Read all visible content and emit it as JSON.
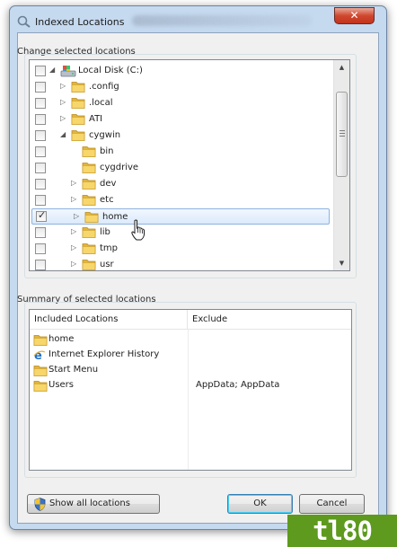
{
  "window": {
    "title": "Indexed Locations",
    "close_glyph": "✕"
  },
  "change_section": {
    "label": "Change selected locations"
  },
  "tree": [
    {
      "label": "Local Disk (C:)",
      "checked": false,
      "expander": "expanded",
      "icon": "drive-icon"
    },
    {
      "label": ".config",
      "checked": false,
      "expander": "collapsed",
      "icon": "folder-icon"
    },
    {
      "label": ".local",
      "checked": false,
      "expander": "collapsed",
      "icon": "folder-icon"
    },
    {
      "label": "ATI",
      "checked": false,
      "expander": "collapsed",
      "icon": "folder-icon"
    },
    {
      "label": "cygwin",
      "checked": false,
      "expander": "expanded",
      "icon": "folder-icon"
    },
    {
      "label": "bin",
      "checked": false,
      "expander": "none",
      "icon": "folder-icon"
    },
    {
      "label": "cygdrive",
      "checked": false,
      "expander": "none",
      "icon": "folder-icon"
    },
    {
      "label": "dev",
      "checked": false,
      "expander": "collapsed",
      "icon": "folder-icon"
    },
    {
      "label": "etc",
      "checked": false,
      "expander": "collapsed",
      "icon": "folder-icon"
    },
    {
      "label": "home",
      "checked": true,
      "expander": "collapsed",
      "icon": "folder-icon",
      "selected": true
    },
    {
      "label": "lib",
      "checked": false,
      "expander": "collapsed",
      "icon": "folder-icon"
    },
    {
      "label": "tmp",
      "checked": false,
      "expander": "collapsed",
      "icon": "folder-icon"
    },
    {
      "label": "usr",
      "checked": false,
      "expander": "collapsed",
      "icon": "folder-icon"
    }
  ],
  "summary_section": {
    "label": "Summary of selected locations",
    "columns": [
      "Included Locations",
      "Exclude"
    ],
    "rows": [
      {
        "icon": "folder-icon",
        "name": "home",
        "exclude": ""
      },
      {
        "icon": "ie-icon",
        "name": "Internet Explorer History",
        "exclude": ""
      },
      {
        "icon": "folder-icon",
        "name": "Start Menu",
        "exclude": ""
      },
      {
        "icon": "folder-icon",
        "name": "Users",
        "exclude": "AppData; AppData"
      }
    ]
  },
  "buttons": {
    "show_all": "Show all locations",
    "ok": "OK",
    "cancel": "Cancel"
  },
  "watermark": "tl80",
  "colors": {
    "frame": "#c5d9ef",
    "selection": "#dbeafb",
    "folder": "#f0c94f",
    "watermark_bg": "#5d9a1e"
  }
}
